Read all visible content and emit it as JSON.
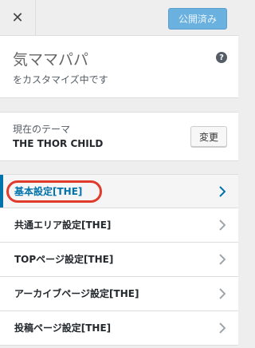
{
  "header": {
    "close_glyph": "✕",
    "publish_label": "公開済み"
  },
  "site": {
    "title": "気ママパパ",
    "subtitle": "をカスタマイズ中です",
    "help_glyph": "?"
  },
  "theme": {
    "label": "現在のテーマ",
    "name": "THE THOR CHILD",
    "change_label": "変更"
  },
  "menu": {
    "items": [
      {
        "label": "基本設定[THE]",
        "active": true
      },
      {
        "label": "共通エリア設定[THE]",
        "active": false
      },
      {
        "label": "TOPページ設定[THE]",
        "active": false
      },
      {
        "label": "アーカイブページ設定[THE]",
        "active": false
      },
      {
        "label": "投稿ページ設定[THE]",
        "active": false
      }
    ]
  },
  "colors": {
    "accent": "#0073aa",
    "publish": "#6ab1e0",
    "highlight": "#e03a2b"
  }
}
